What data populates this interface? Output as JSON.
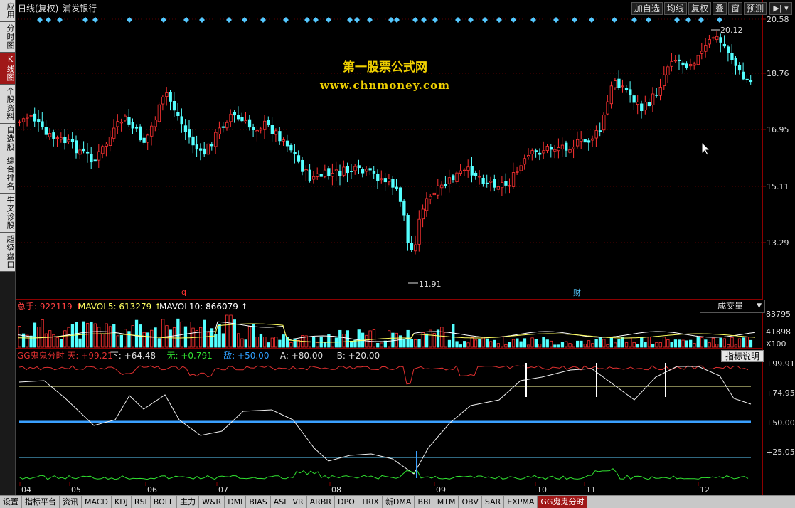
{
  "sidebar": {
    "items": [
      {
        "label": "应用",
        "active": false
      },
      {
        "label": "分时图",
        "active": false
      },
      {
        "label": "K线图",
        "active": true
      },
      {
        "label": "个股资料",
        "active": false
      },
      {
        "label": "自选股",
        "active": false
      },
      {
        "label": "综合排名",
        "active": false
      },
      {
        "label": "牛叉诊股",
        "active": false
      },
      {
        "label": "超级盘口",
        "active": false
      }
    ]
  },
  "header": {
    "title": "日线(复权)",
    "stock": "浦发银行"
  },
  "toolbar": {
    "items": [
      "加自选",
      "均线",
      "复权",
      "叠",
      "窗",
      "预测"
    ],
    "icon": "arrow-right-bar-icon"
  },
  "watermark": {
    "line1": "第一股票公式网",
    "line2": "www.chnmoney.com"
  },
  "price_axis": [
    "20.58",
    "18.76",
    "16.95",
    "15.11",
    "13.29"
  ],
  "price_marks": {
    "high": "20.12",
    "low": "11.91",
    "q_mark": "q",
    "cai_mark": "财"
  },
  "volume": {
    "legend_total": "总手: 922119",
    "legend_mavol5": "MAVOL5: 613279",
    "legend_mavol10": "MAVOL10: 866079",
    "dropdown": "成交量",
    "axis": [
      "83795",
      "41898",
      "X100"
    ]
  },
  "indicator": {
    "legend": [
      {
        "text": "GG鬼鬼分时 天: +99.21",
        "color": "#e03030"
      },
      {
        "text": "下: +64.48",
        "color": "#e0e0e0"
      },
      {
        "text": "无: +0.791",
        "color": "#30e030"
      },
      {
        "text": "敌: +50.00",
        "color": "#30a0ff"
      },
      {
        "text": "A: +80.00",
        "color": "#e0e0e0"
      },
      {
        "text": "B: +20.00",
        "color": "#e0e0e0"
      }
    ],
    "help_button": "指标说明",
    "axis": [
      "+99.91",
      "+74.95",
      "+50.00",
      "+25.05"
    ]
  },
  "months": [
    "04",
    "05",
    "06",
    "07",
    "08",
    "09",
    "10",
    "11",
    "12"
  ],
  "tabs": [
    "设置",
    "指标平台",
    "资讯",
    "MACD",
    "KDJ",
    "RSI",
    "BOLL",
    "主力",
    "W&R",
    "DMI",
    "BIAS",
    "ASI",
    "VR",
    "ARBR",
    "DPO",
    "TRIX",
    "新DMA",
    "BBI",
    "MTM",
    "OBV",
    "SAR",
    "EXPMA",
    "GG鬼鬼分时"
  ],
  "active_tab": "GG鬼鬼分时",
  "colors": {
    "up": "#ff3232",
    "down": "#54ffff",
    "axis": "#8b0000",
    "ma5": "#ffffff",
    "ma10": "#ffff00",
    "blue_line": "#3aa0ff"
  }
}
